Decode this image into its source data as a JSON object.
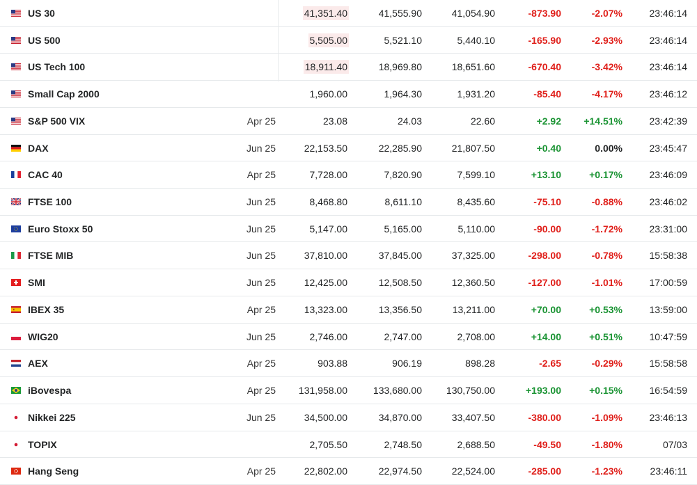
{
  "colors": {
    "negative": "#e0201b",
    "positive": "#1b9434",
    "highlight": "#fbeaea",
    "border": "#e6e9eb"
  },
  "rows": [
    {
      "flag": "us",
      "name": "US 30",
      "month": "",
      "last": "41,351.40",
      "highlight": true,
      "high": "41,555.90",
      "low": "41,054.90",
      "chg": "-873.90",
      "chgp": "-2.07%",
      "dir": "neg",
      "time": "23:46:14"
    },
    {
      "flag": "us",
      "name": "US 500",
      "month": "",
      "last": "5,505.00",
      "highlight": true,
      "high": "5,521.10",
      "low": "5,440.10",
      "chg": "-165.90",
      "chgp": "-2.93%",
      "dir": "neg",
      "time": "23:46:14"
    },
    {
      "flag": "us",
      "name": "US Tech 100",
      "month": "",
      "last": "18,911.40",
      "highlight": true,
      "high": "18,969.80",
      "low": "18,651.60",
      "chg": "-670.40",
      "chgp": "-3.42%",
      "dir": "neg",
      "time": "23:46:14"
    },
    {
      "flag": "us",
      "name": "Small Cap 2000",
      "month": "",
      "last": "1,960.00",
      "highlight": false,
      "high": "1,964.30",
      "low": "1,931.20",
      "chg": "-85.40",
      "chgp": "-4.17%",
      "dir": "neg",
      "time": "23:46:12"
    },
    {
      "flag": "us",
      "name": "S&P 500 VIX",
      "month": "Apr 25",
      "last": "23.08",
      "highlight": false,
      "high": "24.03",
      "low": "22.60",
      "chg": "+2.92",
      "chgp": "+14.51%",
      "dir": "pos",
      "time": "23:42:39"
    },
    {
      "flag": "de",
      "name": "DAX",
      "month": "Jun 25",
      "last": "22,153.50",
      "highlight": false,
      "high": "22,285.90",
      "low": "21,807.50",
      "chg": "+0.40",
      "chgp": "0.00%",
      "dir": "mixed",
      "time": "23:45:47"
    },
    {
      "flag": "fr",
      "name": "CAC 40",
      "month": "Apr 25",
      "last": "7,728.00",
      "highlight": false,
      "high": "7,820.90",
      "low": "7,599.10",
      "chg": "+13.10",
      "chgp": "+0.17%",
      "dir": "pos",
      "time": "23:46:09"
    },
    {
      "flag": "gb",
      "name": "FTSE 100",
      "month": "Jun 25",
      "last": "8,468.80",
      "highlight": false,
      "high": "8,611.10",
      "low": "8,435.60",
      "chg": "-75.10",
      "chgp": "-0.88%",
      "dir": "neg",
      "time": "23:46:02"
    },
    {
      "flag": "eu",
      "name": "Euro Stoxx 50",
      "month": "Jun 25",
      "last": "5,147.00",
      "highlight": false,
      "high": "5,165.00",
      "low": "5,110.00",
      "chg": "-90.00",
      "chgp": "-1.72%",
      "dir": "neg",
      "time": "23:31:00"
    },
    {
      "flag": "it",
      "name": "FTSE MIB",
      "month": "Jun 25",
      "last": "37,810.00",
      "highlight": false,
      "high": "37,845.00",
      "low": "37,325.00",
      "chg": "-298.00",
      "chgp": "-0.78%",
      "dir": "neg",
      "time": "15:58:38"
    },
    {
      "flag": "ch",
      "name": "SMI",
      "month": "Jun 25",
      "last": "12,425.00",
      "highlight": false,
      "high": "12,508.50",
      "low": "12,360.50",
      "chg": "-127.00",
      "chgp": "-1.01%",
      "dir": "neg",
      "time": "17:00:59"
    },
    {
      "flag": "es",
      "name": "IBEX 35",
      "month": "Apr 25",
      "last": "13,323.00",
      "highlight": false,
      "high": "13,356.50",
      "low": "13,211.00",
      "chg": "+70.00",
      "chgp": "+0.53%",
      "dir": "pos",
      "time": "13:59:00"
    },
    {
      "flag": "pl",
      "name": "WIG20",
      "month": "Jun 25",
      "last": "2,746.00",
      "highlight": false,
      "high": "2,747.00",
      "low": "2,708.00",
      "chg": "+14.00",
      "chgp": "+0.51%",
      "dir": "pos",
      "time": "10:47:59"
    },
    {
      "flag": "nl",
      "name": "AEX",
      "month": "Apr 25",
      "last": "903.88",
      "highlight": false,
      "high": "906.19",
      "low": "898.28",
      "chg": "-2.65",
      "chgp": "-0.29%",
      "dir": "neg",
      "time": "15:58:58"
    },
    {
      "flag": "br",
      "name": "iBovespa",
      "month": "Apr 25",
      "last": "131,958.00",
      "highlight": false,
      "high": "133,680.00",
      "low": "130,750.00",
      "chg": "+193.00",
      "chgp": "+0.15%",
      "dir": "pos",
      "time": "16:54:59"
    },
    {
      "flag": "jp",
      "name": "Nikkei 225",
      "month": "Jun 25",
      "last": "34,500.00",
      "highlight": false,
      "high": "34,870.00",
      "low": "33,407.50",
      "chg": "-380.00",
      "chgp": "-1.09%",
      "dir": "neg",
      "time": "23:46:13"
    },
    {
      "flag": "jp",
      "name": "TOPIX",
      "month": "",
      "last": "2,705.50",
      "highlight": false,
      "high": "2,748.50",
      "low": "2,688.50",
      "chg": "-49.50",
      "chgp": "-1.80%",
      "dir": "neg",
      "time": "07/03"
    },
    {
      "flag": "hk",
      "name": "Hang Seng",
      "month": "Apr 25",
      "last": "22,802.00",
      "highlight": false,
      "high": "22,974.50",
      "low": "22,524.00",
      "chg": "-285.00",
      "chgp": "-1.23%",
      "dir": "neg",
      "time": "23:46:11"
    }
  ]
}
